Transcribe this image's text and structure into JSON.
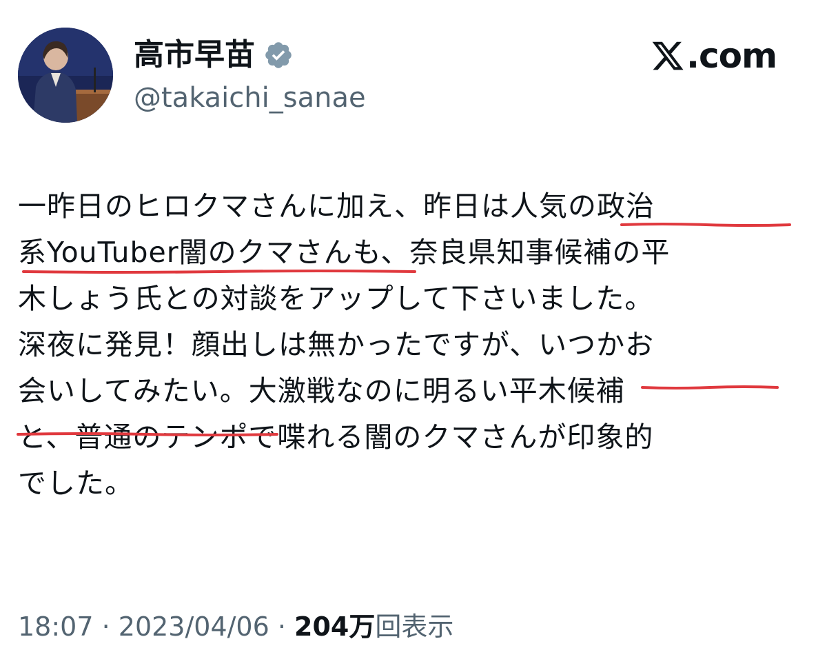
{
  "author": {
    "name": "高市早苗",
    "handle": "@takaichi_sanae",
    "verified_icon": "verified-badge-icon"
  },
  "brand": {
    "label": "𝕏.com",
    "text": ".com",
    "icon": "x-logo-icon"
  },
  "tweet": {
    "lines": [
      "一昨日のヒロクマさんに加え、昨日は人気の政治",
      "系YouTuber闇のクマさんも、奈良県知事候補の平",
      "木しょう氏との対談をアップして下さいました。",
      "深夜に発見！顔出しは無かったですが、いつかお",
      "会いしてみたい。大激戦なのに明るい平木候補",
      "と、普通のテンポで喋れる闇のクマさんが印象的",
      "でした。"
    ]
  },
  "meta": {
    "time": "18:07",
    "separator": " · ",
    "date": "2023/04/06",
    "views_count": "204万",
    "views_label": "回表示"
  },
  "colors": {
    "text": "#0f1419",
    "secondary": "#536471",
    "verified": "#829aab",
    "underline": "#e0393e"
  }
}
